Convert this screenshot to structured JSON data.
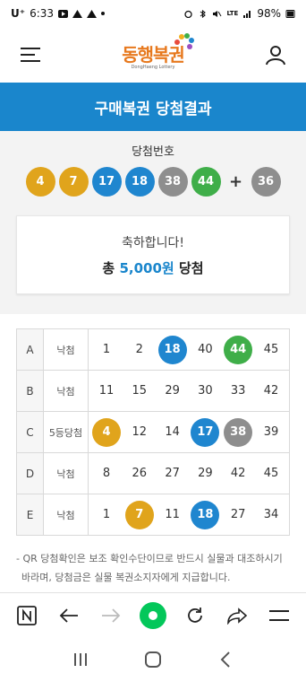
{
  "status_bar": {
    "carrier": "U⁺",
    "time": "6:33",
    "lte": "LTE",
    "battery": "98%"
  },
  "header": {
    "logo_text": "동행복권",
    "logo_sub": "DongHaeng Lottery",
    "icons": [
      "hamburger-menu-icon",
      "user-profile-icon"
    ]
  },
  "title": "구매복권 당첨결과",
  "winning": {
    "label": "당첨번호",
    "numbers": [
      {
        "value": "4",
        "color": "#e0a41c"
      },
      {
        "value": "7",
        "color": "#e0a41c"
      },
      {
        "value": "17",
        "color": "#1f86cf"
      },
      {
        "value": "18",
        "color": "#1f86cf"
      },
      {
        "value": "38",
        "color": "#8e8e8e"
      },
      {
        "value": "44",
        "color": "#3fae49"
      }
    ],
    "plus": "+",
    "bonus": {
      "value": "36",
      "color": "#8e8e8e"
    }
  },
  "congrats": {
    "message": "축하합니다!",
    "prefix": "총",
    "amount": "5,000원",
    "suffix": "당첨"
  },
  "results": [
    {
      "label": "A",
      "rank": "낙첨",
      "nums": [
        {
          "v": "1"
        },
        {
          "v": "2"
        },
        {
          "v": "18",
          "c": "#1f86cf"
        },
        {
          "v": "40"
        },
        {
          "v": "44",
          "c": "#3fae49"
        },
        {
          "v": "45"
        }
      ]
    },
    {
      "label": "B",
      "rank": "낙첨",
      "nums": [
        {
          "v": "11"
        },
        {
          "v": "15"
        },
        {
          "v": "29"
        },
        {
          "v": "30"
        },
        {
          "v": "33"
        },
        {
          "v": "42"
        }
      ]
    },
    {
      "label": "C",
      "rank": "5등당첨",
      "nums": [
        {
          "v": "4",
          "c": "#e0a41c"
        },
        {
          "v": "12"
        },
        {
          "v": "14"
        },
        {
          "v": "17",
          "c": "#1f86cf"
        },
        {
          "v": "38",
          "c": "#8e8e8e"
        },
        {
          "v": "39"
        }
      ]
    },
    {
      "label": "D",
      "rank": "낙첨",
      "nums": [
        {
          "v": "8"
        },
        {
          "v": "26"
        },
        {
          "v": "27"
        },
        {
          "v": "29"
        },
        {
          "v": "42"
        },
        {
          "v": "45"
        }
      ]
    },
    {
      "label": "E",
      "rank": "낙첨",
      "nums": [
        {
          "v": "1"
        },
        {
          "v": "7",
          "c": "#e0a41c"
        },
        {
          "v": "11"
        },
        {
          "v": "18",
          "c": "#1f86cf"
        },
        {
          "v": "27"
        },
        {
          "v": "34"
        }
      ]
    }
  ],
  "notice": [
    "- QR 당첨확인은 보조 확인수단이므로 반드시 실물과 대조하시기",
    "  바라며, 당첨금은 실물 복권소지자에게 지급합니다."
  ],
  "browser_toolbar": [
    "naver-n-icon",
    "back-arrow-icon",
    "forward-arrow-icon",
    "home-green-circle-icon",
    "refresh-icon",
    "share-icon",
    "menu-lines-icon"
  ],
  "android_nav": [
    "recent-apps-icon",
    "home-button-icon",
    "back-button-icon"
  ],
  "colors": {
    "primary_blue": "#1a86cc",
    "yellow": "#e0a41c",
    "blue": "#1f86cf",
    "gray": "#8e8e8e",
    "green": "#3fae49"
  }
}
